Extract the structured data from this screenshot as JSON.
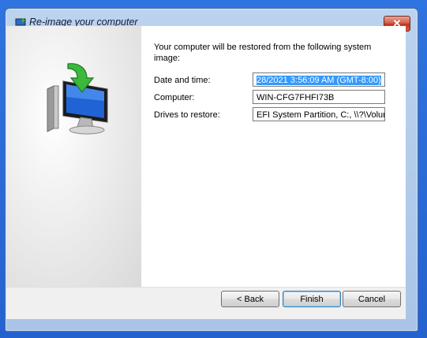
{
  "window": {
    "title": "Re-image your computer",
    "close_label": "✕"
  },
  "content": {
    "intro": "Your computer will be restored from the following system image:",
    "rows": [
      {
        "label": "Date and time:",
        "value": "28/2021 3:56:09 AM (GMT-8:00)"
      },
      {
        "label": "Computer:",
        "value": "WIN-CFG7FHFI73B"
      },
      {
        "label": "Drives to restore:",
        "value": "EFI System Partition, C:, \\\\?\\Volur"
      }
    ]
  },
  "buttons": {
    "back": "< Back",
    "finish": "Finish",
    "cancel": "Cancel"
  },
  "icons": {
    "app": "restore-app-icon",
    "hero": "computer-restore-icon",
    "close": "close-icon"
  },
  "colors": {
    "desktop": "#2b6fd6",
    "selection": "#3399ff",
    "close_button": "#c2351c"
  }
}
